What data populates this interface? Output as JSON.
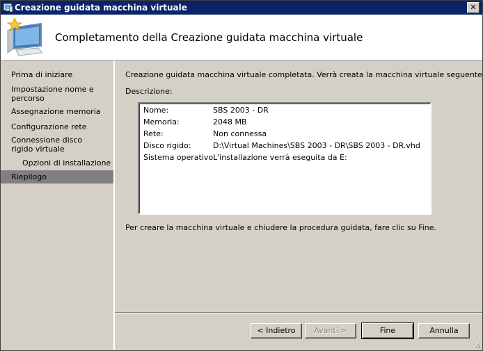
{
  "window": {
    "title": "Creazione guidata macchina virtuale",
    "close_label": "✕"
  },
  "header": {
    "heading": "Completamento della Creazione guidata macchina virtuale"
  },
  "sidebar": {
    "items": [
      {
        "label": "Prima di iniziare"
      },
      {
        "label": "Impostazione nome e percorso"
      },
      {
        "label": "Assegnazione memoria"
      },
      {
        "label": "Configurazione rete"
      },
      {
        "label": "Connessione disco rigido virtuale"
      },
      {
        "label": "Opzioni di installazione"
      },
      {
        "label": "Riepilogo"
      }
    ],
    "active": "Riepilogo"
  },
  "content": {
    "intro": "Creazione guidata macchina virtuale completata. Verrà creata la macchina virtuale seguente.",
    "description_label": "Descrizione:",
    "summary": [
      {
        "key": "Nome:",
        "value": "SBS 2003 - DR"
      },
      {
        "key": "Memoria:",
        "value": "2048 MB"
      },
      {
        "key": "Rete:",
        "value": "Non connessa"
      },
      {
        "key": "Disco rigido:",
        "value": "D:\\Virtual Machines\\SBS 2003 - DR\\SBS 2003 - DR.vhd"
      },
      {
        "key": "Sistema operativo:",
        "value": "L'installazione verrà eseguita da E:"
      }
    ],
    "finish_text": "Per creare la macchina virtuale e chiudere la procedura guidata, fare clic su Fine."
  },
  "buttons": {
    "back": "< Indietro",
    "next": "Avanti >",
    "finish": "Fine",
    "cancel": "Annulla"
  },
  "colors": {
    "titlebar": "#0a246a",
    "face": "#d4d0c8",
    "active_nav": "#808080"
  }
}
